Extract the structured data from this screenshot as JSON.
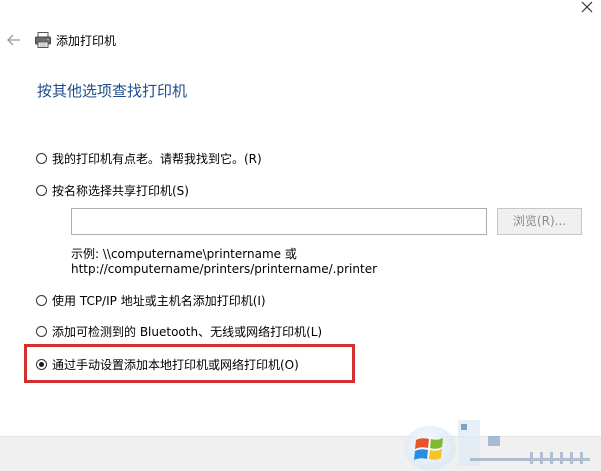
{
  "window": {
    "title": "添加打印机"
  },
  "main": {
    "heading": "按其他选项查找打印机",
    "options": [
      {
        "label": "我的打印机有点老。请帮我找到它。(R)",
        "selected": false
      },
      {
        "label": "按名称选择共享打印机(S)",
        "selected": false
      },
      {
        "label": "使用 TCP/IP 地址或主机名添加打印机(I)",
        "selected": false
      },
      {
        "label": "添加可检测到的 Bluetooth、无线或网络打印机(L)",
        "selected": false
      },
      {
        "label": "通过手动设置添加本地打印机或网络打印机(O)",
        "selected": true
      }
    ],
    "share_input": {
      "value": "",
      "placeholder": ""
    },
    "browse_label": "浏览(R)...",
    "example_line1": "示例: \\\\computername\\printername 或",
    "example_line2": "http://computername/printers/printername/.printer"
  },
  "colors": {
    "heading": "#1e4e8c",
    "highlight": "#d0302f",
    "footer": "#f0f0f0"
  },
  "icons": {
    "close": "close-icon",
    "back": "back-arrow-icon",
    "printer": "printer-icon",
    "watermark": "windows-logo-icon"
  }
}
